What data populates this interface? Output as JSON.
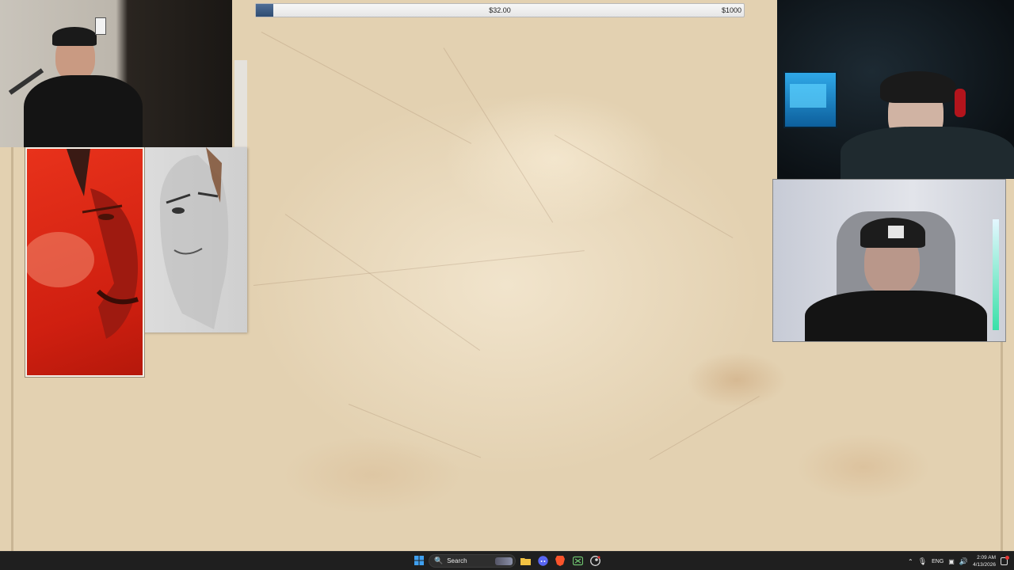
{
  "game": {
    "bid_bar": {
      "current_label": "$32.00",
      "max_label": "$1000",
      "progress": 0.035
    }
  },
  "taskbar": {
    "search_label": "Search",
    "language": "ENG",
    "time": "2:09 AM",
    "date": "4/13/2026",
    "apps": [
      "start-icon",
      "search-icon",
      "file-explorer-icon",
      "discord-icon",
      "brave-icon",
      "xbox-icon",
      "steam-icon"
    ]
  },
  "colors": {
    "parchment": "#e9dbc0",
    "card_red": "#d9261a",
    "bar_fill": "#3a5a83",
    "taskbar": "#1f1f1f"
  }
}
